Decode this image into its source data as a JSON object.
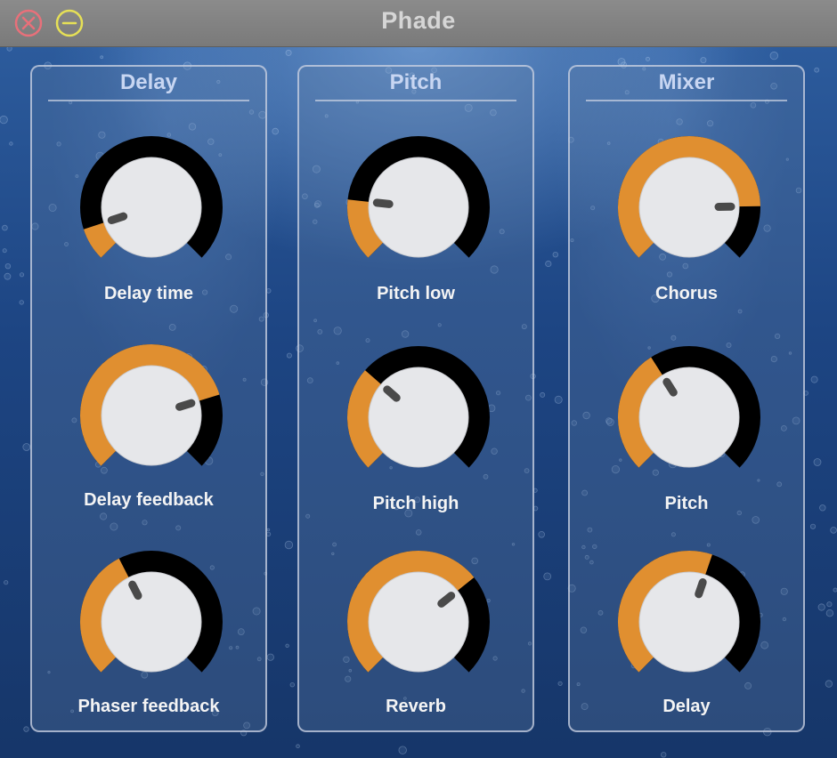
{
  "window": {
    "title": "Phade"
  },
  "titlebar": {
    "close_icon": "close-x-circle-icon",
    "minimize_icon": "minimize-circle-icon"
  },
  "colors": {
    "accent": "#e08f30",
    "track": "#000000",
    "knob_face": "#e6e7ea",
    "pointer": "#4a4a4a",
    "close": "#e8707a",
    "minimize": "#e6e056"
  },
  "panels": [
    {
      "title": "Delay",
      "knobs": [
        {
          "label": "Delay time",
          "value": 0.1
        },
        {
          "label": "Delay feedback",
          "value": 0.77
        },
        {
          "label": "Phaser feedback",
          "value": 0.4
        }
      ]
    },
    {
      "title": "Pitch",
      "knobs": [
        {
          "label": "Pitch low",
          "value": 0.19
        },
        {
          "label": "Pitch high",
          "value": 0.32
        },
        {
          "label": "Reverb",
          "value": 0.69
        }
      ]
    },
    {
      "title": "Mixer",
      "knobs": [
        {
          "label": "Chorus",
          "value": 0.83
        },
        {
          "label": "Pitch",
          "value": 0.38
        },
        {
          "label": "Delay",
          "value": 0.57
        }
      ]
    }
  ]
}
